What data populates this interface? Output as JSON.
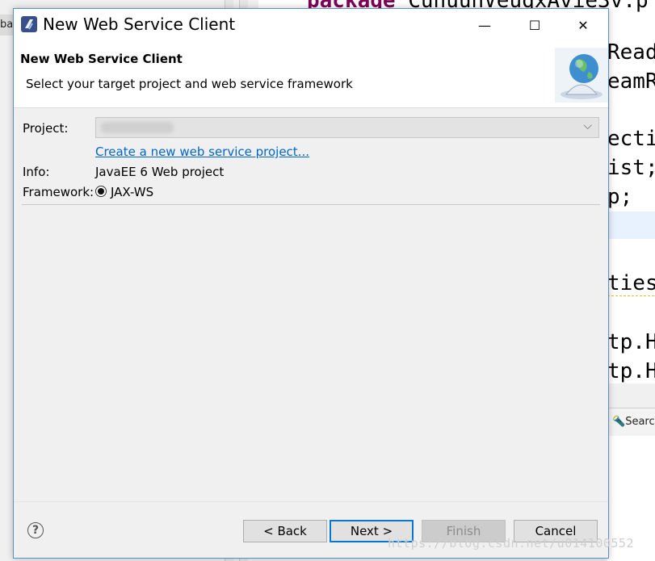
{
  "background": {
    "left_tab_text": "bac",
    "code_top": [
      "package",
      " CunuuhVeuqxAvie3v.p"
    ],
    "code_lines": [
      "Read",
      "eamR",
      "",
      "ecti",
      "ist;",
      "p;",
      "",
      "ties",
      "",
      "tp.H",
      "tp.H"
    ],
    "panel_tab": "Searc",
    "watermark": "https://blog.csdn.net/u014100552"
  },
  "window": {
    "title": "New Web Service Client",
    "minimize_glyph": "—",
    "maximize_glyph": "☐",
    "close_glyph": "✕"
  },
  "header": {
    "title": "New Web Service Client",
    "description": "Select your target project and web service framework"
  },
  "form": {
    "project_label": "Project:",
    "project_value": "",
    "project_dropdown_glyph": "⌵",
    "create_link": "Create a new web service project...",
    "info_label": "Info:",
    "info_value": "JavaEE 6 Web project",
    "framework_label": "Framework:",
    "framework_option": "JAX-WS"
  },
  "buttons": {
    "help_glyph": "?",
    "back": "< Back",
    "next": "Next >",
    "finish": "Finish",
    "cancel": "Cancel"
  },
  "colors": {
    "accent": "#0078d7",
    "link": "#0066cc",
    "dialog_border": "#5a8fc8",
    "keyword": "#7f0055"
  }
}
